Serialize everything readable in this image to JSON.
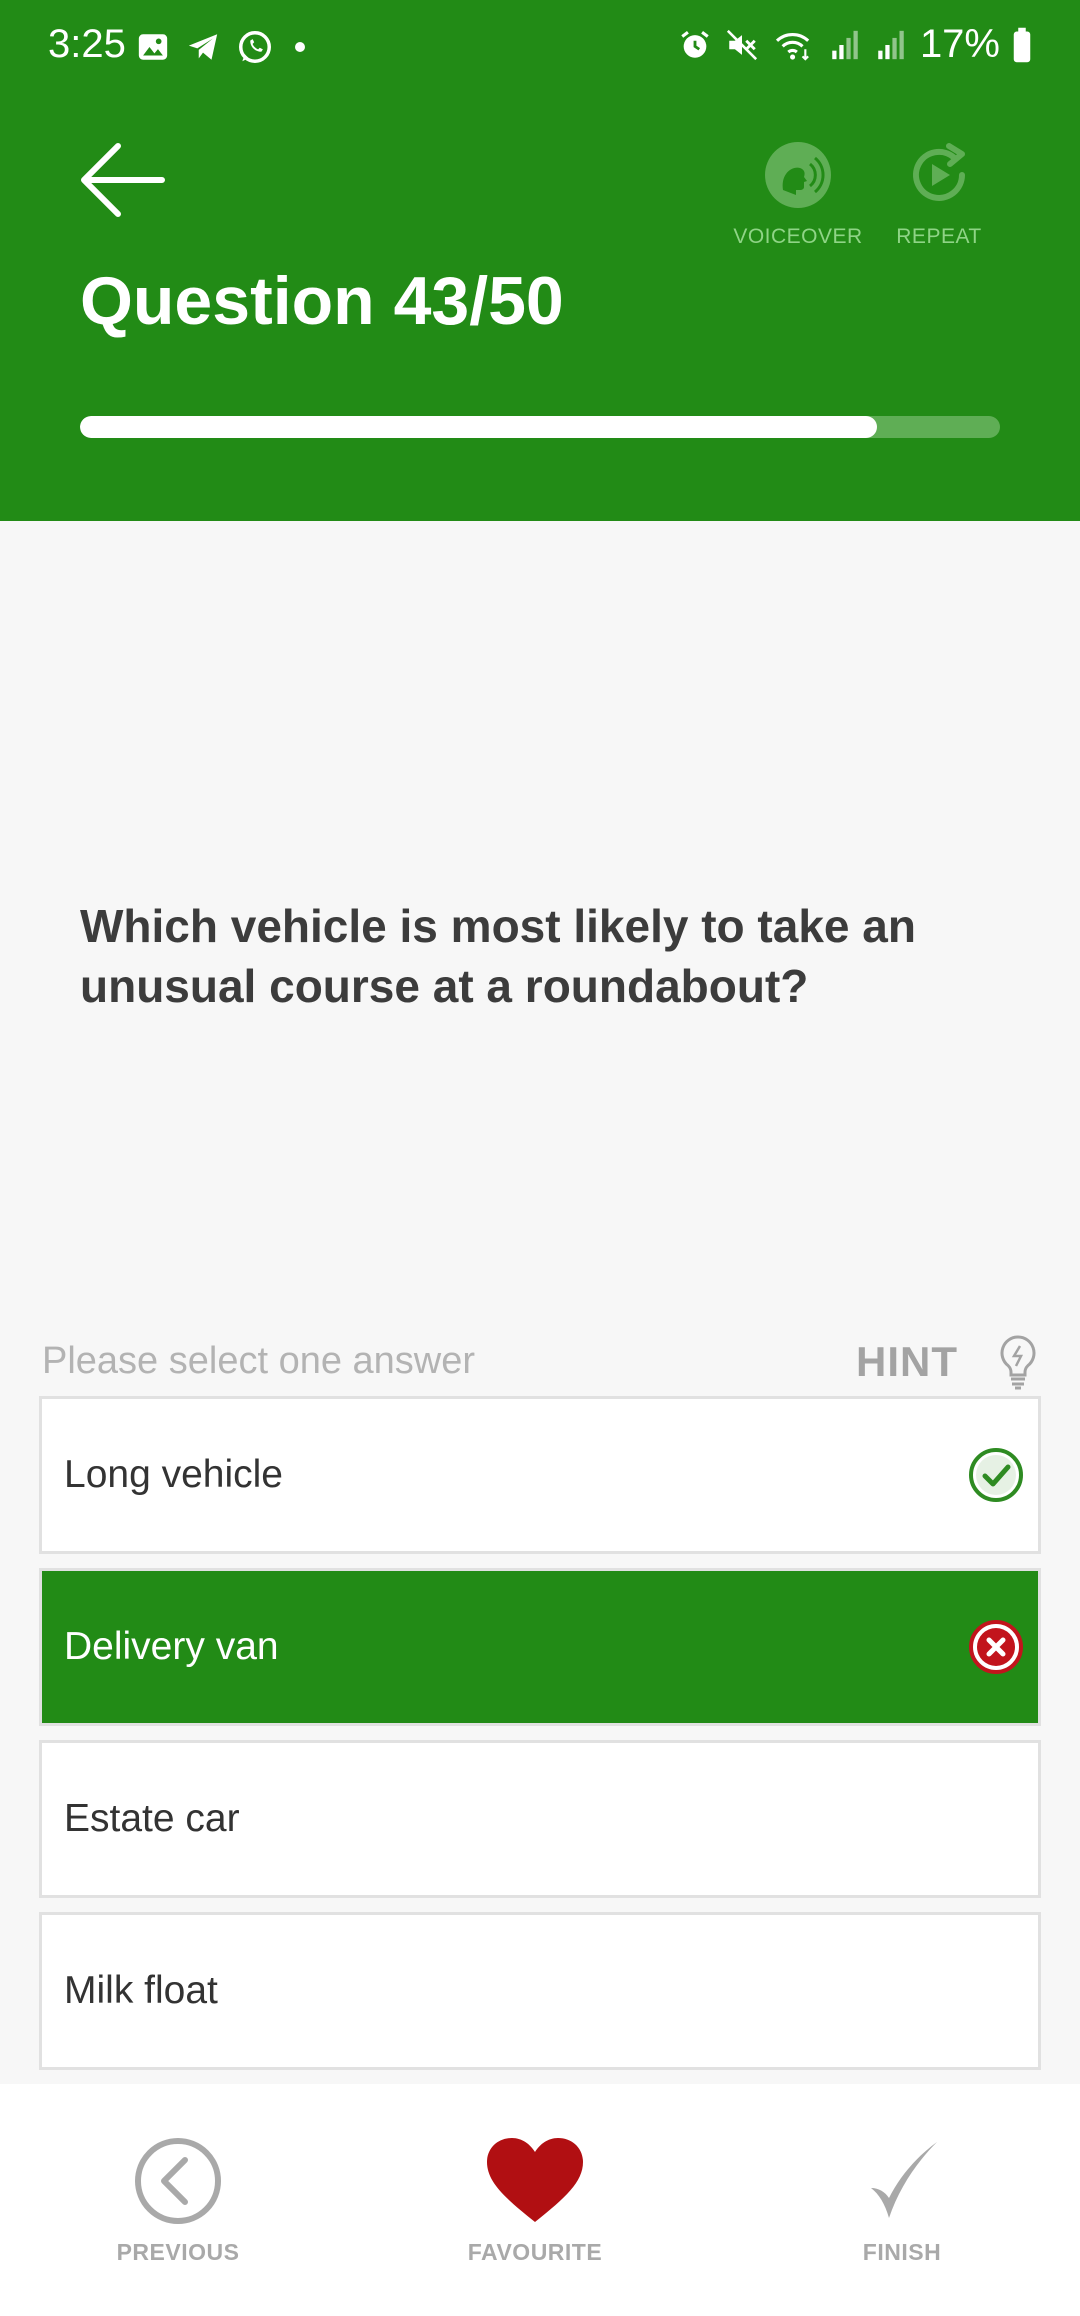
{
  "status_bar": {
    "time": "3:25",
    "battery": "17%"
  },
  "header": {
    "title": "Question 43/50",
    "voiceover_label": "VOICEOVER",
    "repeat_label": "REPEAT",
    "progress_fraction": 0.866
  },
  "question": {
    "text": "Which vehicle is most likely to take an unusual course at a roundabout?"
  },
  "answers_section": {
    "prompt": "Please select one answer",
    "hint_label": "HINT"
  },
  "answers": [
    {
      "label": "Long vehicle",
      "state": "correct"
    },
    {
      "label": "Delivery van",
      "state": "wrong-selected"
    },
    {
      "label": "Estate car",
      "state": "none"
    },
    {
      "label": "Milk float",
      "state": "none"
    }
  ],
  "bottom_nav": {
    "previous_label": "PREVIOUS",
    "favourite_label": "FAVOURITE",
    "finish_label": "FINISH"
  },
  "colors": {
    "brand_green": "#228b16",
    "favourite_red": "#b10f12",
    "correct_green": "#2e8b22",
    "wrong_red": "#c2141c"
  }
}
